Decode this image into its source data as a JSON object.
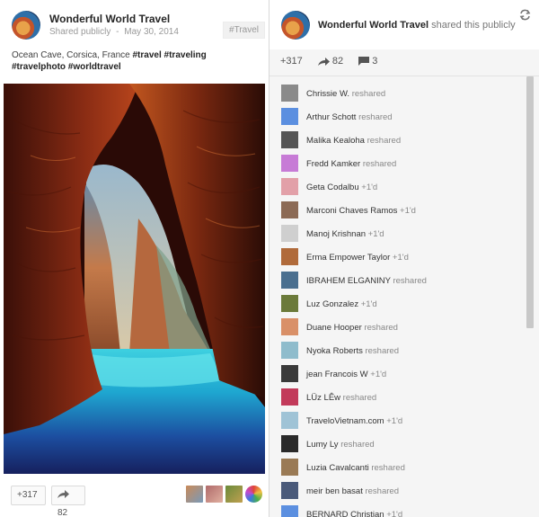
{
  "post": {
    "author": "Wonderful World Travel",
    "visibility": "Shared publicly",
    "separator": "-",
    "date": "May 30, 2014",
    "tag": "#Travel",
    "text_plain": "Ocean Cave, Corsica, France",
    "hashtags": [
      "#travel",
      "#traveling",
      "#travelphoto",
      "#worldtravel"
    ],
    "plus_count": "+317",
    "share_count": "82"
  },
  "panel": {
    "author": "Wonderful World Travel",
    "action": "shared this publicly",
    "plus_count": "+317",
    "share_count": "82",
    "comment_count": "3",
    "people": [
      {
        "name": "Chrissie W.",
        "action": "reshared",
        "color": "#8a8a8a"
      },
      {
        "name": "Arthur Schott",
        "action": "reshared",
        "color": "#5b8fe0"
      },
      {
        "name": "Malika Kealoha",
        "action": "reshared",
        "color": "#555555"
      },
      {
        "name": "Fredd Kamker",
        "action": "reshared",
        "color": "#c77bd6"
      },
      {
        "name": "Geta Codalbu",
        "action": "+1'd",
        "color": "#e2a0a8"
      },
      {
        "name": "Marconi Chaves Ramos",
        "action": "+1'd",
        "color": "#8c6a55"
      },
      {
        "name": "Manoj Krishnan",
        "action": "+1'd",
        "color": "#cfcfcf"
      },
      {
        "name": "Erma Empower Taylor",
        "action": "+1'd",
        "color": "#b06a3a"
      },
      {
        "name": "IBRAHEM ELGANINY",
        "action": "reshared",
        "color": "#4a6f8f"
      },
      {
        "name": "Luz Gonzalez",
        "action": "+1'd",
        "color": "#6b7a3a"
      },
      {
        "name": "Duane Hooper",
        "action": "reshared",
        "color": "#d99068"
      },
      {
        "name": "Nyoka Roberts",
        "action": "reshared",
        "color": "#8fbccc"
      },
      {
        "name": "jean Francois W",
        "action": "+1'd",
        "color": "#3a3a3a"
      },
      {
        "name": "LÜz LÊw",
        "action": "reshared",
        "color": "#c23a5a"
      },
      {
        "name": "TraveloVietnam.com",
        "action": "+1'd",
        "color": "#9fc3d6"
      },
      {
        "name": "Lumy Ly",
        "action": "reshared",
        "color": "#2a2a2a"
      },
      {
        "name": "Luzia Cavalcanti",
        "action": "reshared",
        "color": "#9a7a55"
      },
      {
        "name": "meir ben basat",
        "action": "reshared",
        "color": "#4a5a7a"
      },
      {
        "name": "BERNARD Christian",
        "action": "+1'd",
        "color": "#5b8fe0"
      }
    ]
  },
  "colors": {
    "accent_link": "#262626",
    "panel_bg": "#f5f5f5",
    "scrollbar": "#c8c8c8"
  }
}
